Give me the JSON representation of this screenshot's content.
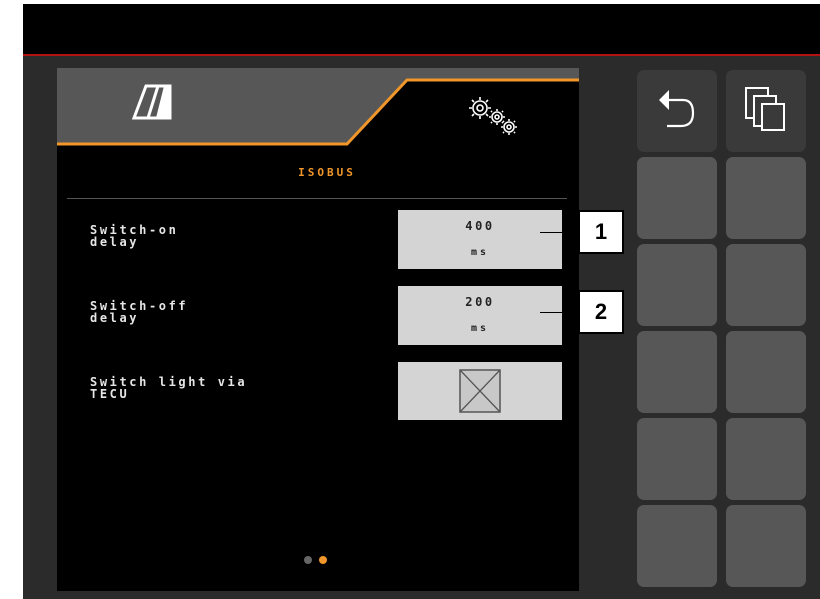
{
  "screen": {
    "tabs": [
      {
        "name": "machine-tab",
        "icon": "machine-icon",
        "active": false
      },
      {
        "name": "settings-tab",
        "icon": "gears-icon",
        "active": true
      }
    ],
    "section_title": "ISOBUS",
    "settings": [
      {
        "label": "Switch-on\ndelay",
        "value": "400",
        "unit": "ms"
      },
      {
        "label": "Switch-off\ndelay",
        "value": "200",
        "unit": "ms"
      },
      {
        "label": "Switch light via\nTECU",
        "checked": false
      }
    ],
    "pagination": {
      "pages": 2,
      "current": 2
    }
  },
  "softkeys": [
    {
      "name": "back",
      "icon": "back-arrow-icon"
    },
    {
      "name": "copy",
      "icon": "copy-pages-icon"
    }
  ],
  "callouts": [
    "1",
    "2"
  ],
  "colors": {
    "accent": "#f0962a",
    "panel": "#000000",
    "softkey": "#575757",
    "frame": "#2b2b2b",
    "value_box": "#d4d4d4",
    "topbar_line": "#b31212"
  }
}
